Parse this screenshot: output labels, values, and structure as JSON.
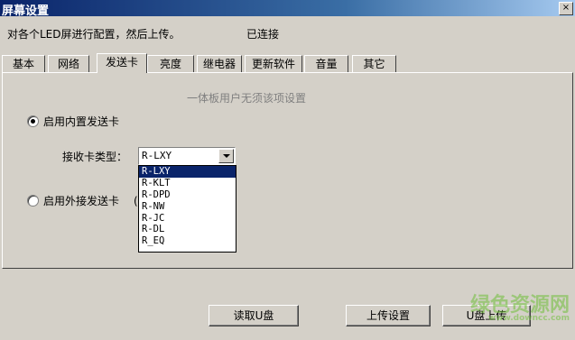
{
  "window": {
    "title": "屏幕设置",
    "close_symbol": "×"
  },
  "info_text": "对各个LED屏进行配置，然后上传。",
  "status_text": "已连接",
  "tabs": [
    {
      "label": "基本"
    },
    {
      "label": "网络"
    },
    {
      "label": "发送卡"
    },
    {
      "label": "亮度"
    },
    {
      "label": "继电器"
    },
    {
      "label": "更新软件"
    },
    {
      "label": "音量"
    },
    {
      "label": "其它"
    }
  ],
  "active_tab": "发送卡",
  "panel": {
    "note": "一体板用户无须该项设置",
    "builtin_radio_label": "启用内置发送卡",
    "builtin_checked": true,
    "receiver_label": "接收卡类型：",
    "receiver_value": "R-LXY",
    "receiver_options": [
      "R-LXY",
      "R-KLT",
      "R-DPD",
      "R-NW",
      "R-JC",
      "R-DL",
      "R_EQ"
    ],
    "external_radio_label": "启用外接发送卡",
    "external_checked": false,
    "external_partial": "("
  },
  "buttons": {
    "read_usb": "读取U盘",
    "upload_settings": "上传设置",
    "usb_upload": "U盘上传"
  },
  "watermark": {
    "text": "绿色资源网",
    "url": "www.downcc.com"
  }
}
